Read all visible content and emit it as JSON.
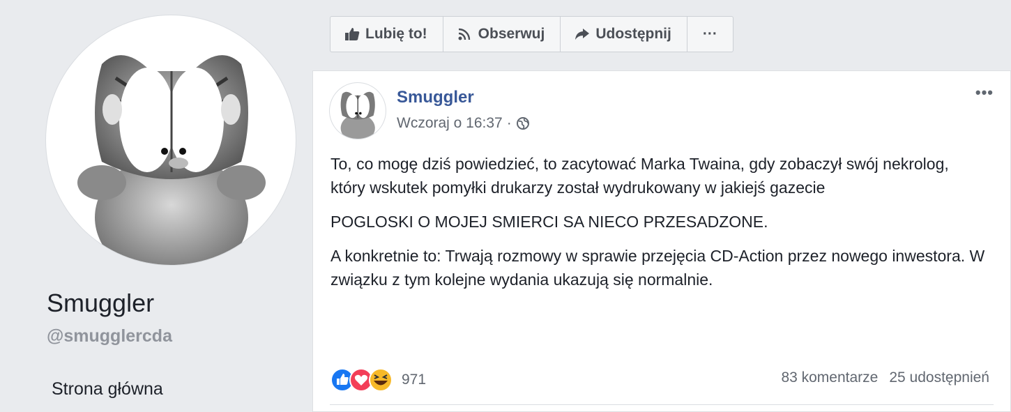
{
  "sidebar": {
    "page_name": "Smuggler",
    "handle": "@smugglercda",
    "nav_home": "Strona główna"
  },
  "actions": {
    "like": "Lubię to!",
    "follow": "Obserwuj",
    "share": "Udostępnij",
    "more": "···"
  },
  "post": {
    "author": "Smuggler",
    "timestamp": "Wczoraj o 16:37",
    "separator": "·",
    "more": "•••",
    "paragraphs": [
      "To, co mogę dziś powiedzieć, to zacytować Marka Twaina, gdy zobaczył swój nekrolog, który wskutek pomyłki drukarzy został wydrukowany w jakiejś gazecie",
      "POGLOSKI O MOJEJ SMIERCI SA NIECO PRZESADZONE.",
      "A konkretnie to: Trwają rozmowy w sprawie przejęcia CD-Action przez nowego inwestora. W związku z tym kolejne wydania ukazują się normalnie."
    ],
    "reaction_count": "971",
    "comments": "83 komentarze",
    "shares": "25 udostępnień"
  },
  "colors": {
    "link_blue": "#385898",
    "like_blue": "#1877f2",
    "love_red": "#f33e58",
    "haha_yellow": "#f7b928"
  },
  "icons": [
    "thumbs-up-icon",
    "rss-icon",
    "share-arrow-icon",
    "globe-icon",
    "like-reaction-icon",
    "love-reaction-icon",
    "haha-reaction-icon"
  ]
}
